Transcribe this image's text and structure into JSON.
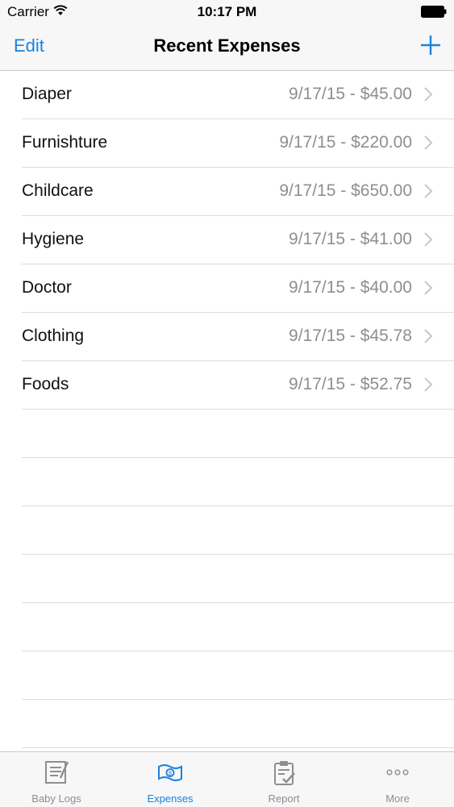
{
  "status": {
    "carrier": "Carrier",
    "time": "10:17 PM"
  },
  "nav": {
    "edit_label": "Edit",
    "title": "Recent Expenses",
    "add_icon": "plus-icon"
  },
  "expenses": [
    {
      "category": "Diaper",
      "detail": "9/17/15 - $45.00"
    },
    {
      "category": "Furnishture",
      "detail": "9/17/15 - $220.00"
    },
    {
      "category": "Childcare",
      "detail": "9/17/15 - $650.00"
    },
    {
      "category": "Hygiene",
      "detail": "9/17/15 - $41.00"
    },
    {
      "category": "Doctor",
      "detail": "9/17/15 - $40.00"
    },
    {
      "category": "Clothing",
      "detail": "9/17/15 - $45.78"
    },
    {
      "category": "Foods",
      "detail": "9/17/15 - $52.75"
    }
  ],
  "tabs": [
    {
      "label": "Baby Logs",
      "icon": "notepad-icon",
      "active": false
    },
    {
      "label": "Expenses",
      "icon": "money-icon",
      "active": true
    },
    {
      "label": "Report",
      "icon": "clipboard-check-icon",
      "active": false
    },
    {
      "label": "More",
      "icon": "more-dots-icon",
      "active": false
    }
  ],
  "colors": {
    "accent": "#1a82e0",
    "secondary_text": "#8e8e93",
    "bar_background": "#f7f7f7"
  }
}
